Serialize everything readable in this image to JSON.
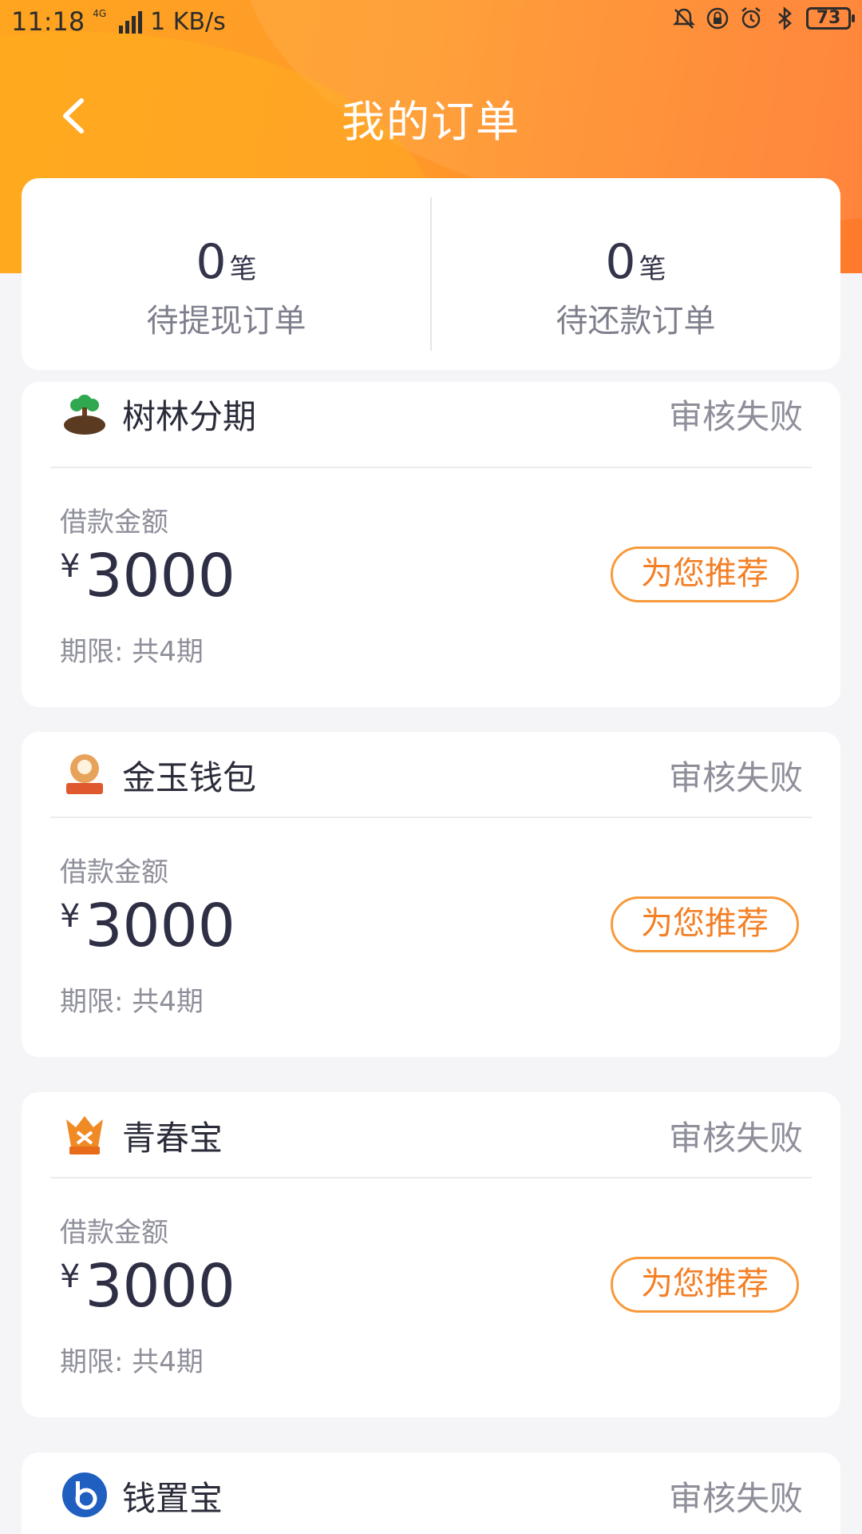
{
  "status_bar": {
    "time": "11:18",
    "network": "4G",
    "speed": "1 KB/s",
    "battery": "73",
    "icons": [
      "bell-muted-icon",
      "lock-rotation-icon",
      "alarm-icon",
      "bluetooth-icon",
      "battery-icon"
    ]
  },
  "nav": {
    "back_icon": "chevron-left-icon",
    "title": "我的订单"
  },
  "summary": {
    "pending_withdraw": {
      "count": "0",
      "unit": "笔",
      "label": "待提现订单"
    },
    "pending_repay": {
      "count": "0",
      "unit": "笔",
      "label": "待还款订单"
    }
  },
  "orders": [
    {
      "name": "树林分期",
      "status": "审核失败",
      "amount_label": "借款金额",
      "currency": "¥",
      "amount": "3000",
      "term": "期限: 共4期",
      "button": "为您推荐",
      "logo": "tree-logo-icon"
    },
    {
      "name": "金玉钱包",
      "status": "审核失败",
      "amount_label": "借款金额",
      "currency": "¥",
      "amount": "3000",
      "term": "期限: 共4期",
      "button": "为您推荐",
      "logo": "jade-wallet-logo-icon"
    },
    {
      "name": "青春宝",
      "status": "审核失败",
      "amount_label": "借款金额",
      "currency": "¥",
      "amount": "3000",
      "term": "期限: 共4期",
      "button": "为您推荐",
      "logo": "youth-treasure-logo-icon"
    },
    {
      "name": "钱置宝",
      "status": "审核失败",
      "logo": "money-treasure-logo-icon"
    }
  ],
  "colors": {
    "header_start": "#ffa51f",
    "header_end": "#ff7a2c",
    "accent": "#f47f25",
    "background": "#f5f5f8"
  }
}
